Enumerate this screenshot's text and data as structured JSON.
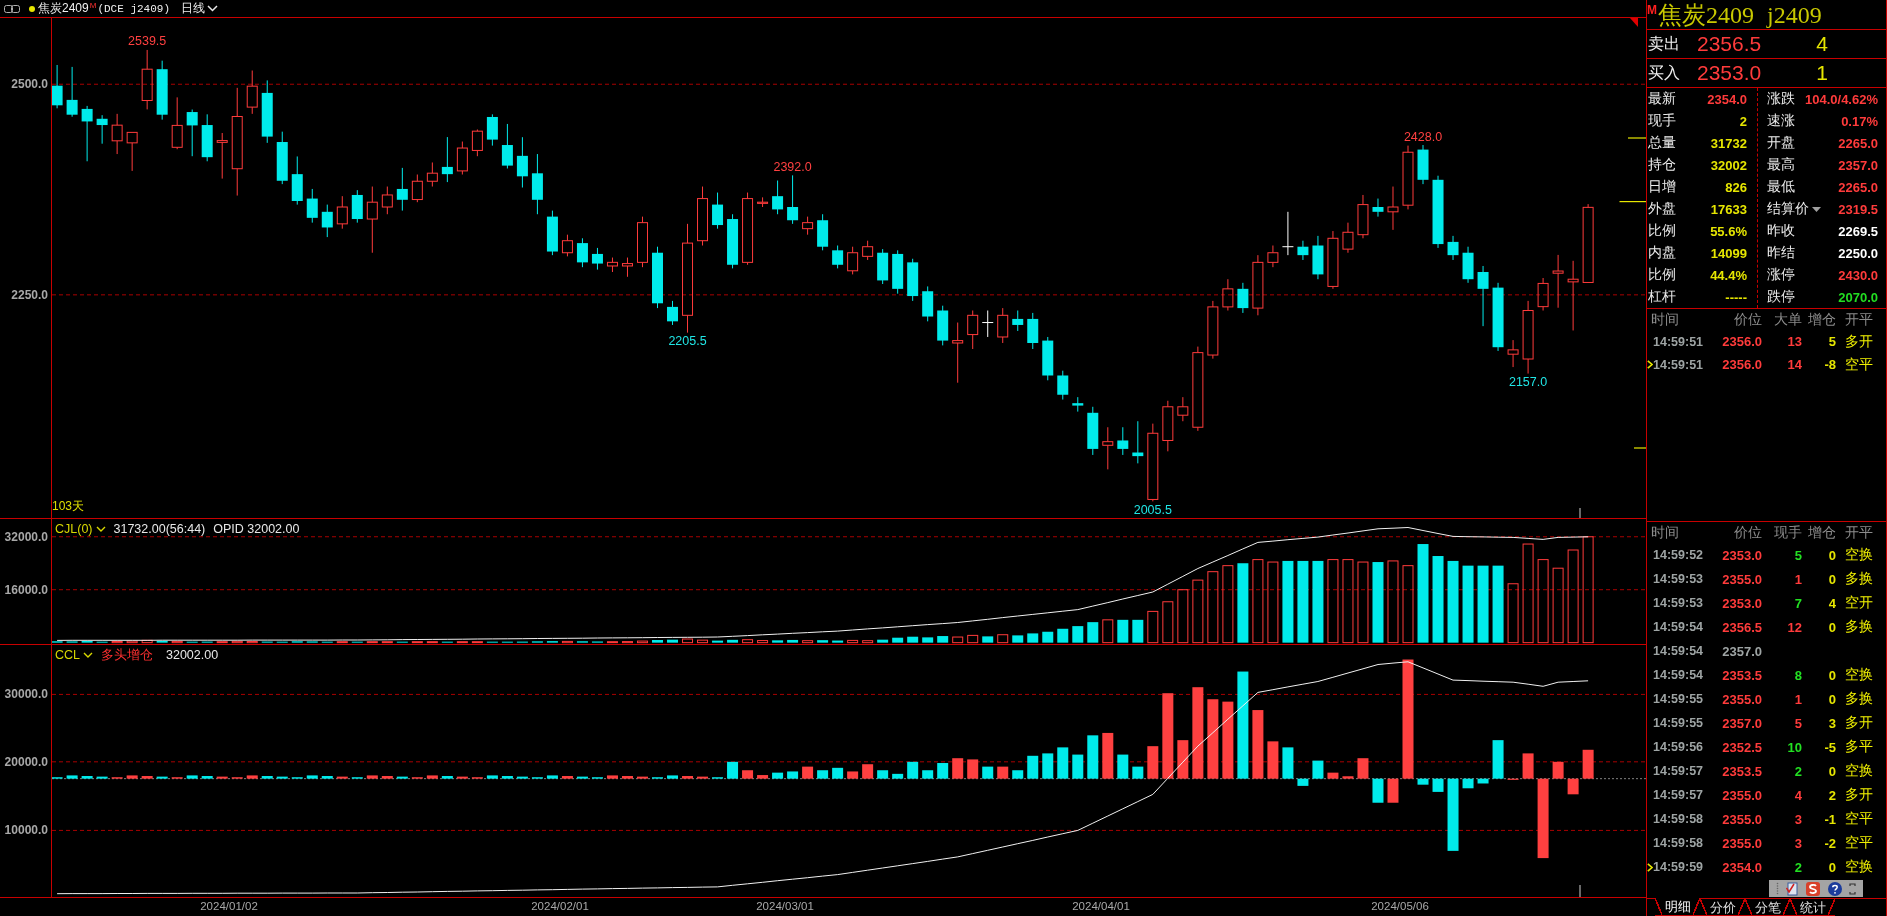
{
  "header": {
    "symbol": "焦炭2409",
    "badge": "M",
    "code": "(DCE j2409)",
    "period": "日线"
  },
  "main_chart": {
    "y_axis": [
      "2500.0",
      "2250.0"
    ],
    "price_labels": [
      {
        "text": "2539.5",
        "kind": "high"
      },
      {
        "text": "2392.0",
        "kind": "high"
      },
      {
        "text": "2205.5",
        "kind": "low"
      },
      {
        "text": "2005.5",
        "kind": "low"
      },
      {
        "text": "2428.0",
        "kind": "high"
      },
      {
        "text": "2157.0",
        "kind": "low"
      }
    ],
    "day_count": "103天"
  },
  "volume_panel": {
    "indicator": "CJL(0)",
    "value": "31732.00(56:44)",
    "extra": "OPID 32002.00",
    "y_axis": [
      "32000.0",
      "16000.0"
    ]
  },
  "oi_panel": {
    "indicator": "CCL",
    "signal": "多头增仓",
    "value": "32002.00",
    "y_axis": [
      "30000.0",
      "20000.0",
      "10000.0"
    ]
  },
  "x_axis": [
    "2024/01/02",
    "2024/02/01",
    "2024/03/01",
    "2024/04/01",
    "2024/05/06"
  ],
  "quote": {
    "badge": "M",
    "name": "焦炭2409",
    "code": "j2409",
    "book": [
      {
        "label": "卖出",
        "price": "2356.5",
        "volume": "4"
      },
      {
        "label": "买入",
        "price": "2353.0",
        "volume": "1"
      }
    ],
    "stats_left": [
      {
        "label": "最新",
        "value": "2354.0",
        "color": "#ff3b3b"
      },
      {
        "label": "现手",
        "value": "2",
        "color": "#e6e600"
      },
      {
        "label": "总量",
        "value": "31732",
        "color": "#e6e600"
      },
      {
        "label": "持仓",
        "value": "32002",
        "color": "#e6e600"
      },
      {
        "label": "日增",
        "value": "826",
        "color": "#e6e600"
      },
      {
        "label": "外盘",
        "value": "17633",
        "color": "#e6e600"
      },
      {
        "label": "比例",
        "value": "55.6%",
        "color": "#e6e600"
      },
      {
        "label": "内盘",
        "value": "14099",
        "color": "#e6e600"
      },
      {
        "label": "比例",
        "value": "44.4%",
        "color": "#e6e600"
      },
      {
        "label": "杠杆",
        "value": "-----",
        "color": "#e6e600"
      }
    ],
    "stats_right": [
      {
        "label": "涨跌",
        "value": "104.0/4.62%",
        "color": "#ff3b3b",
        "dropdown": false
      },
      {
        "label": "速涨",
        "value": "0.17%",
        "color": "#ff3b3b",
        "dropdown": false
      },
      {
        "label": "开盘",
        "value": "2265.0",
        "color": "#ff3b3b",
        "dropdown": false
      },
      {
        "label": "最高",
        "value": "2357.0",
        "color": "#ff3b3b",
        "dropdown": false
      },
      {
        "label": "最低",
        "value": "2265.0",
        "color": "#ff3b3b",
        "dropdown": false
      },
      {
        "label": "结算价",
        "value": "2319.5",
        "color": "#ff3b3b",
        "dropdown": true
      },
      {
        "label": "昨收",
        "value": "2269.5",
        "color": "#ffffff",
        "dropdown": false
      },
      {
        "label": "昨结",
        "value": "2250.0",
        "color": "#ffffff",
        "dropdown": false
      },
      {
        "label": "涨停",
        "value": "2430.0",
        "color": "#ff3b3b",
        "dropdown": false
      },
      {
        "label": "跌停",
        "value": "2070.0",
        "color": "#22dd22",
        "dropdown": false
      }
    ]
  },
  "big_orders": {
    "columns": [
      "时间",
      "价位",
      "大单",
      "增仓",
      "开平"
    ],
    "rows": [
      {
        "time": "14:59:51",
        "price": "2356.0",
        "size": "13",
        "buy": true,
        "oi_change": "5",
        "action": "多开",
        "marked": false
      },
      {
        "time": "14:59:51",
        "price": "2356.0",
        "size": "14",
        "buy": true,
        "oi_change": "-8",
        "action": "空平",
        "marked": true
      }
    ]
  },
  "ticks": {
    "columns": [
      "时间",
      "价位",
      "现手",
      "增仓",
      "开平"
    ],
    "rows": [
      {
        "kind": "trade",
        "time": "14:59:52",
        "price": "2353.0",
        "volume": "5",
        "buy": false,
        "oi_change": "0",
        "action": "空换",
        "marked": false
      },
      {
        "kind": "trade",
        "time": "14:59:53",
        "price": "2355.0",
        "volume": "1",
        "buy": true,
        "oi_change": "0",
        "action": "多换",
        "marked": false
      },
      {
        "kind": "trade",
        "time": "14:59:53",
        "price": "2353.0",
        "volume": "7",
        "buy": false,
        "oi_change": "4",
        "action": "空开",
        "marked": false
      },
      {
        "kind": "trade",
        "time": "14:59:54",
        "price": "2356.5",
        "volume": "12",
        "buy": true,
        "oi_change": "0",
        "action": "多换",
        "marked": false
      },
      {
        "kind": "quote",
        "time": "14:59:54",
        "price": "2357.0",
        "marked": false
      },
      {
        "kind": "trade",
        "time": "14:59:54",
        "price": "2353.5",
        "volume": "8",
        "buy": false,
        "oi_change": "0",
        "action": "空换",
        "marked": false
      },
      {
        "kind": "trade",
        "time": "14:59:55",
        "price": "2355.0",
        "volume": "1",
        "buy": true,
        "oi_change": "0",
        "action": "多换",
        "marked": false
      },
      {
        "kind": "trade",
        "time": "14:59:55",
        "price": "2357.0",
        "volume": "5",
        "buy": true,
        "oi_change": "3",
        "action": "多开",
        "marked": false
      },
      {
        "kind": "trade",
        "time": "14:59:56",
        "price": "2352.5",
        "volume": "10",
        "buy": false,
        "oi_change": "-5",
        "action": "多平",
        "marked": false
      },
      {
        "kind": "trade",
        "time": "14:59:57",
        "price": "2353.5",
        "volume": "2",
        "buy": false,
        "oi_change": "0",
        "action": "空换",
        "marked": false
      },
      {
        "kind": "trade",
        "time": "14:59:57",
        "price": "2355.0",
        "volume": "4",
        "buy": true,
        "oi_change": "2",
        "action": "多开",
        "marked": false
      },
      {
        "kind": "trade",
        "time": "14:59:58",
        "price": "2355.0",
        "volume": "3",
        "buy": true,
        "oi_change": "-1",
        "action": "空平",
        "marked": false
      },
      {
        "kind": "trade",
        "time": "14:59:58",
        "price": "2355.0",
        "volume": "3",
        "buy": true,
        "oi_change": "-2",
        "action": "空平",
        "marked": false
      },
      {
        "kind": "trade",
        "time": "14:59:59",
        "price": "2354.0",
        "volume": "2",
        "buy": false,
        "oi_change": "0",
        "action": "空换",
        "marked": true
      }
    ]
  },
  "tabs": [
    {
      "label": "明细",
      "selected": true
    },
    {
      "label": "分价",
      "selected": false
    },
    {
      "label": "分笔",
      "selected": false
    },
    {
      "label": "统计",
      "selected": false
    }
  ]
}
